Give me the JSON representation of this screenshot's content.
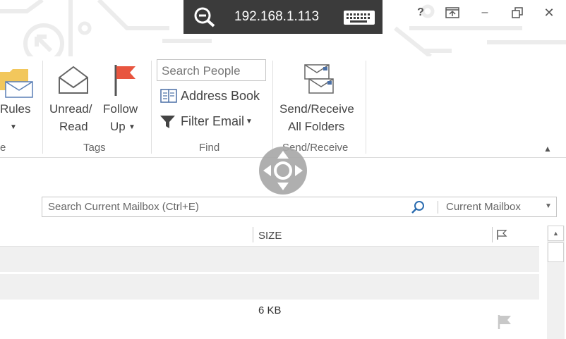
{
  "remote": {
    "ip": "192.168.1.113",
    "zoom_icon": "zoom-out-icon",
    "keyboard_icon": "keyboard-icon"
  },
  "window_controls": {
    "help": "?",
    "restore_ribbon_icon": "ribbon-display-options-icon",
    "minimize": "–",
    "maximize_icon": "restore-window-icon",
    "close": "✕"
  },
  "ribbon": {
    "rules": {
      "label": "Rules"
    },
    "partial_group_label": "e",
    "tags": {
      "unread_read_line1": "Unread/",
      "unread_read_line2": "Read",
      "follow_up_line1": "Follow",
      "follow_up_line2": "Up",
      "group_label": "Tags"
    },
    "find": {
      "search_people_placeholder": "Search People",
      "address_book": "Address Book",
      "filter_email": "Filter Email",
      "group_label": "Find"
    },
    "send_receive": {
      "line1": "Send/Receive",
      "line2": "All Folders",
      "group_label": "Send/Receive"
    }
  },
  "mailbox_search": {
    "placeholder": "Search Current Mailbox (Ctrl+E)",
    "scope": "Current Mailbox"
  },
  "list": {
    "columns": {
      "size": "SIZE"
    },
    "rows": [
      {
        "size": ""
      },
      {
        "size": ""
      },
      {
        "size": "6 KB"
      }
    ]
  },
  "colors": {
    "remote_bar": "#3b3b3b",
    "flag_red": "#e8553f",
    "search_icon_blue": "#2b6cb0",
    "row_gray": "#f0f0f0"
  }
}
